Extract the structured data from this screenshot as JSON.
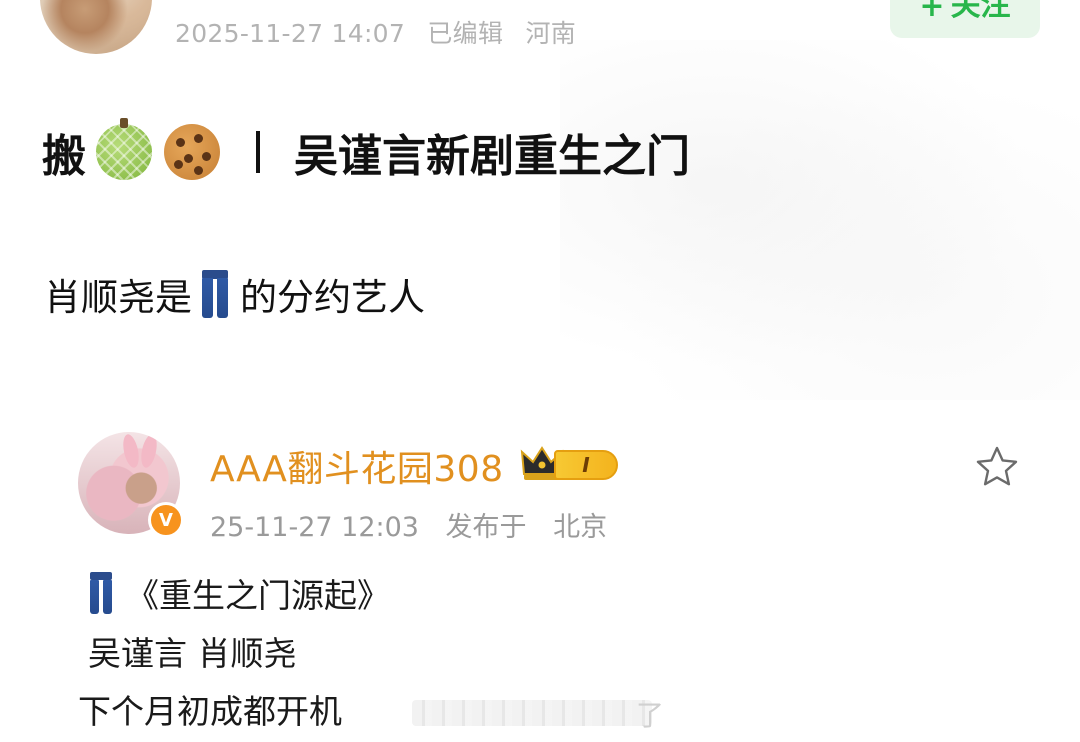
{
  "header": {
    "timestamp": "2025-11-27 14:07",
    "edited": "已编辑",
    "location": "河南",
    "follow_label": "关注",
    "follow_plus": "+"
  },
  "post": {
    "title_prefix": "搬",
    "title_text": "吴谨言新剧重生之门",
    "title_emojis": [
      "melon-emoji",
      "cookie-emoji"
    ],
    "line_before": "肖顺尧是",
    "line_after": "的分约艺人",
    "line_emoji": "jeans-emoji"
  },
  "repost": {
    "author": "AAA翻斗花园308",
    "level": "I",
    "time": "25-11-27 12:03",
    "published_at": "发布于",
    "location": "北京",
    "line1": "《重生之门源起》",
    "line2": "吴谨言 肖顺尧",
    "line3": "下个月初成都开机",
    "redaction_tail": "了"
  },
  "colors": {
    "accent_green": "#28b64b",
    "author_gold": "#e1901f",
    "meta_gray": "#b3b3b3",
    "verified_orange": "#f7931e"
  }
}
